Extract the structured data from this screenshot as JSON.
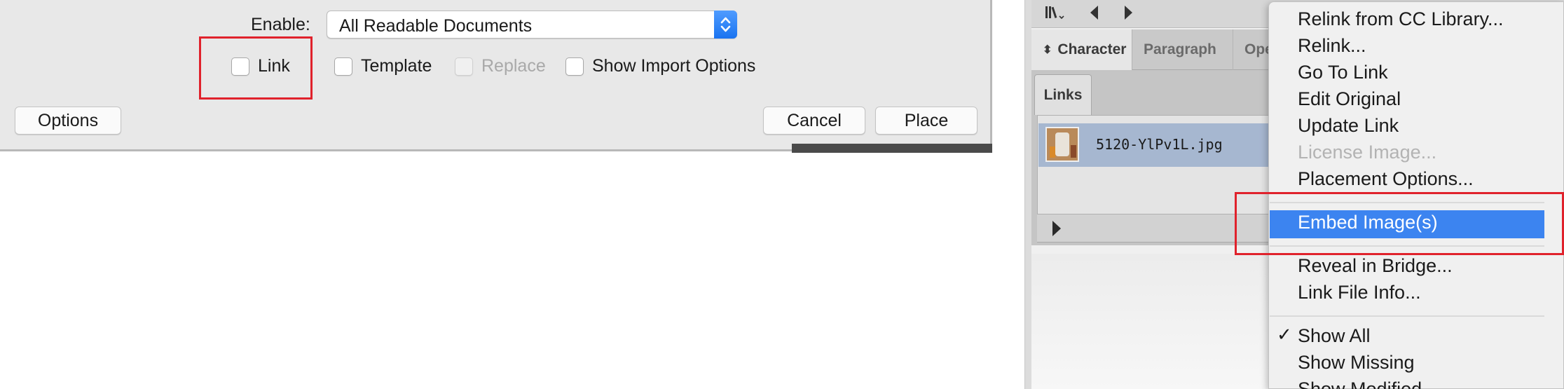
{
  "dialog": {
    "enable_label": "Enable:",
    "enable_value": "All Readable Documents",
    "checkboxes": {
      "link": "Link",
      "template": "Template",
      "replace": "Replace",
      "show_import_options": "Show Import Options"
    },
    "buttons": {
      "options": "Options",
      "cancel": "Cancel",
      "place": "Place"
    }
  },
  "panel": {
    "tabs": {
      "character": "Character",
      "paragraph": "Paragraph",
      "ope": "Ope"
    },
    "links_tab": "Links",
    "link_file": "5120-YlPv1L.jpg"
  },
  "menu": {
    "relink_cc": "Relink from CC Library...",
    "relink": "Relink...",
    "go_to_link": "Go To Link",
    "edit_original": "Edit Original",
    "update_link": "Update Link",
    "license_image": "License Image...",
    "placement_options": "Placement Options...",
    "embed_images": "Embed Image(s)",
    "reveal_in_bridge": "Reveal in Bridge...",
    "link_file_info": "Link File Info...",
    "check": "✓",
    "show_all": "Show All",
    "show_missing": "Show Missing",
    "show_modified": "Show Modified"
  },
  "colors": {
    "highlight": "#e0222c",
    "menu_selection": "#3c84f0",
    "select_stepper": "#1a73f0"
  }
}
